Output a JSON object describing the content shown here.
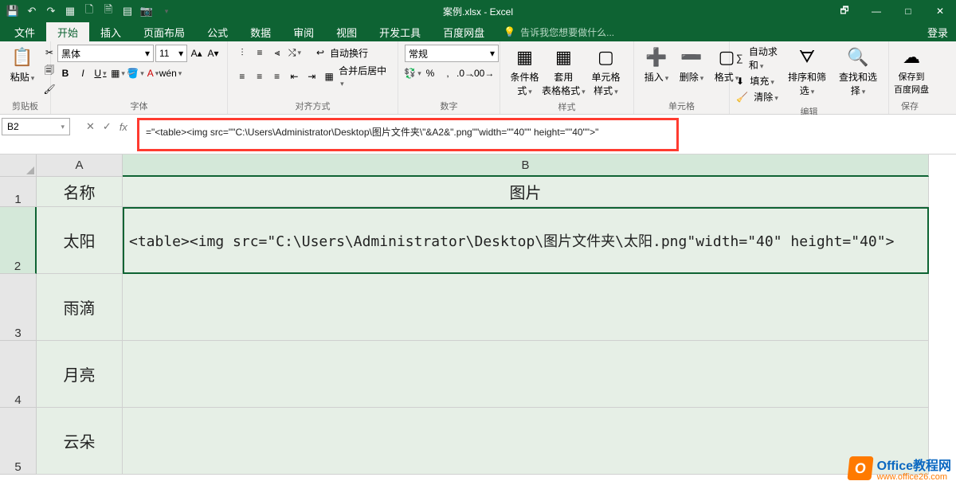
{
  "titlebar": {
    "title": "案例.xlsx - Excel",
    "qat_icons": [
      "save-icon",
      "undo-icon",
      "redo-icon",
      "grid-icon",
      "new-icon",
      "page-icon",
      "table-icon",
      "camera-icon",
      "customize-icon"
    ]
  },
  "win": {
    "restore": "🗗",
    "minimize": "—",
    "maximize": "□",
    "close": "✕"
  },
  "tabs": {
    "file": "文件",
    "items": [
      "开始",
      "插入",
      "页面布局",
      "公式",
      "数据",
      "审阅",
      "视图",
      "开发工具",
      "百度网盘"
    ],
    "active": "开始",
    "tellme_placeholder": "告诉我您想要做什么...",
    "login": "登录"
  },
  "ribbon": {
    "clipboard": {
      "paste": "粘贴",
      "label": "剪贴板"
    },
    "font": {
      "name": "黑体",
      "size": "11",
      "bold": "B",
      "italic": "I",
      "underline": "U",
      "label": "字体"
    },
    "align": {
      "wrap": "自动换行",
      "merge": "合并后居中",
      "label": "对齐方式"
    },
    "number": {
      "format": "常规",
      "label": "数字",
      "percent": "%",
      "comma": ","
    },
    "styles": {
      "cond": "条件格式",
      "table": "套用\n表格格式",
      "cell": "单元格样式",
      "label": "样式"
    },
    "cells": {
      "insert": "插入",
      "delete": "删除",
      "format": "格式",
      "label": "单元格"
    },
    "editing": {
      "sum": "自动求和",
      "fill": "填充",
      "clear": "清除",
      "sort": "排序和筛选",
      "find": "查找和选择",
      "label": "编辑"
    },
    "save": {
      "label": "保存到\n百度网盘",
      "group": "保存"
    }
  },
  "namebox": {
    "ref": "B2"
  },
  "formula": {
    "text": "=\"<table><img src=\"\"C:\\Users\\Administrator\\Desktop\\图片文件夹\\\"&A2&\".png\"\"width=\"\"40\"\" height=\"\"40\"\">\""
  },
  "columns": {
    "A": "A",
    "B": "B"
  },
  "rows": {
    "r1": {
      "num": "1",
      "A": "名称",
      "B": "图片"
    },
    "r2": {
      "num": "2",
      "A": "太阳",
      "B": "<table><img src=\"C:\\Users\\Administrator\\Desktop\\图片文件夹\\太阳.png\"width=\"40\" height=\"40\">"
    },
    "r3": {
      "num": "3",
      "A": "雨滴",
      "B": ""
    },
    "r4": {
      "num": "4",
      "A": "月亮",
      "B": ""
    },
    "r5": {
      "num": "5",
      "A": "云朵",
      "B": ""
    }
  },
  "watermark": {
    "title": "Office教程网",
    "url": "www.office26.com",
    "logo": "O"
  }
}
